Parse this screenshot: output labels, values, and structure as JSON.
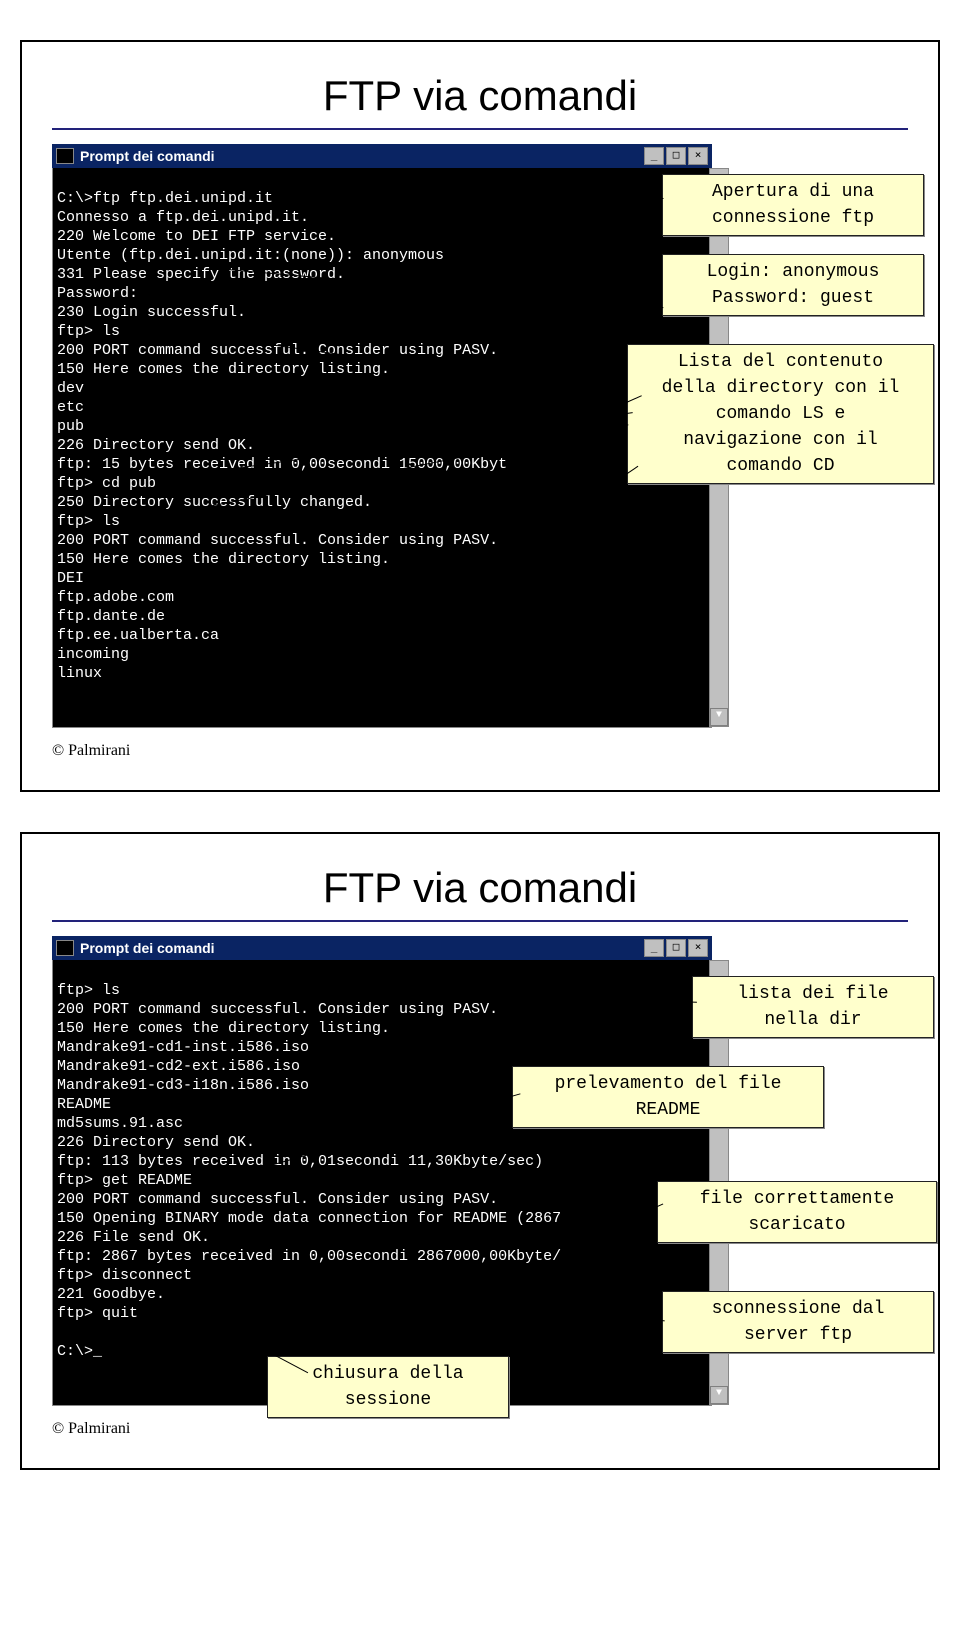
{
  "slide1": {
    "title": "FTP via comandi",
    "term_title": "Prompt dei comandi",
    "win_btns": {
      "min": "_",
      "max": "□",
      "close": "×"
    },
    "scroll": {
      "up": "▲",
      "down": "▼"
    },
    "term_lines": "C:\\>ftp ftp.dei.unipd.it\nConnesso a ftp.dei.unipd.it.\n220 Welcome to DEI FTP service.\nUtente (ftp.dei.unipd.it:(none)): anonymous\n331 Please specify the password.\nPassword:\n230 Login successful.\nftp> ls\n200 PORT command successful. Consider using PASV.\n150 Here comes the directory listing.\ndev\netc\npub\n226 Directory send OK.\nftp: 15 bytes received in 0,00secondi 15000,00Kbyt\nftp> cd pub\n250 Directory successfully changed.\nftp> ls\n200 PORT command successful. Consider using PASV.\n150 Here comes the directory listing.\nDEI\nftp.adobe.com\nftp.dante.de\nftp.ee.ualberta.ca\nincoming\nlinux",
    "ann1": "Apertura di una\nconnessione ftp",
    "ann2": "Login: anonymous\nPassword: guest",
    "ann3": "Lista del contenuto\ndella directory con il\ncomando LS e\nnavigazione con il\ncomando CD",
    "copyright": "© Palmirani"
  },
  "slide2": {
    "title": "FTP via comandi",
    "term_title": "Prompt dei comandi",
    "win_btns": {
      "min": "_",
      "max": "□",
      "close": "×"
    },
    "scroll": {
      "up": "▲",
      "down": "▼"
    },
    "term_lines": "ftp> ls\n200 PORT command successful. Consider using PASV.\n150 Here comes the directory listing.\nMandrake91-cd1-inst.i586.iso\nMandrake91-cd2-ext.i586.iso\nMandrake91-cd3-i18n.i586.iso\nREADME\nmd5sums.91.asc\n226 Directory send OK.\nftp: 113 bytes received in 0,01secondi 11,30Kbyte/sec)\nftp> get README\n200 PORT command successful. Consider using PASV.\n150 Opening BINARY mode data connection for README (2867\n226 File send OK.\nftp: 2867 bytes received in 0,00secondi 2867000,00Kbyte/\nftp> disconnect\n221 Goodbye.\nftp> quit\n\nC:\\>_",
    "ann_list": "lista dei file\nnella dir",
    "ann_prel": "prelevamento del file\nREADME",
    "ann_down": "file correttamente\nscaricato",
    "ann_disc": "sconnessione dal\nserver ftp",
    "ann_quit": "chiusura della\nsessione",
    "copyright": "© Palmirani"
  }
}
